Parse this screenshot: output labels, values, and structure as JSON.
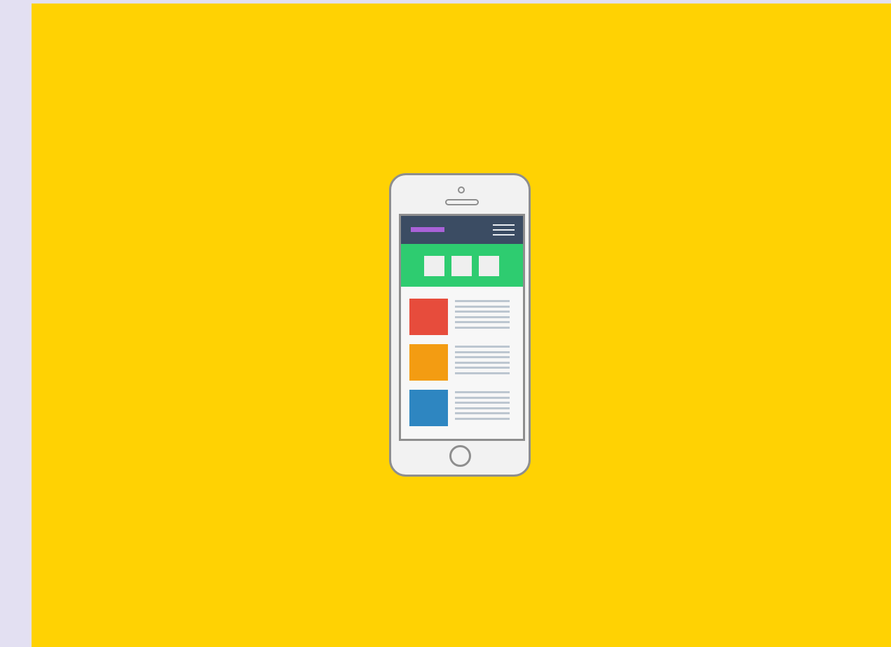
{
  "illustration": {
    "subject": "responsive-mobile-website-icon",
    "colors": {
      "page_background": "#e3e0f2",
      "stage_background": "#ffd203",
      "phone_body": "#f2f2f2",
      "phone_outline": "#8e8e8e",
      "header_bar": "#3b4c63",
      "logo_bar": "#a962d8",
      "hero_banner": "#2ecc70",
      "tile": "#efefef",
      "text_line": "#bcc6d0"
    },
    "cards": [
      {
        "thumbnail_color": "#e74c3c",
        "line_count": 6
      },
      {
        "thumbnail_color": "#f39c12",
        "line_count": 6
      },
      {
        "thumbnail_color": "#2e86c1",
        "line_count": 6
      }
    ],
    "hero_tile_count": 3,
    "icons": [
      "hamburger-menu-icon",
      "camera-icon",
      "speaker-icon",
      "home-button-icon"
    ]
  }
}
